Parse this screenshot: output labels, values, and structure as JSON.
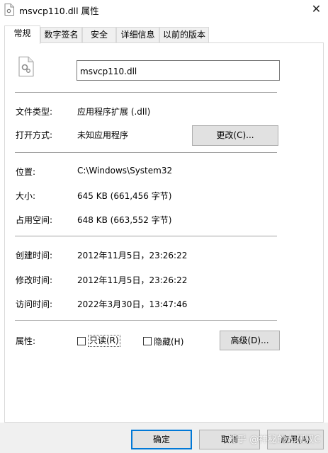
{
  "window": {
    "title": "msvcp110.dll 属性",
    "close_glyph": "✕"
  },
  "tabs": [
    {
      "label": "常规"
    },
    {
      "label": "数字签名"
    },
    {
      "label": "安全"
    },
    {
      "label": "详细信息"
    },
    {
      "label": "以前的版本"
    }
  ],
  "general": {
    "filename": "msvcp110.dll",
    "file_type_label": "文件类型:",
    "file_type_value": "应用程序扩展 (.dll)",
    "opens_with_label": "打开方式:",
    "opens_with_value": "未知应用程序",
    "change_button": "更改(C)...",
    "location_label": "位置:",
    "location_value": "C:\\Windows\\System32",
    "size_label": "大小:",
    "size_value": "645 KB (661,456 字节)",
    "size_on_disk_label": "占用空间:",
    "size_on_disk_value": "648 KB (663,552 字节)",
    "created_label": "创建时间:",
    "created_value": "2012年11月5日，23:26:22",
    "modified_label": "修改时间:",
    "modified_value": "2012年11月5日，23:26:22",
    "accessed_label": "访问时间:",
    "accessed_value": "2022年3月30日，13:47:46",
    "attributes_label": "属性:",
    "readonly_label": "只读(R)",
    "readonly_checked": false,
    "hidden_label": "隐藏(H)",
    "hidden_checked": false,
    "advanced_button": "高级(D)..."
  },
  "footer": {
    "ok_button": "确定",
    "cancel_button": "取消",
    "apply_button": "应用(A)"
  },
  "watermark": "知乎 @神秘的大叔叔C",
  "colors": {
    "accent_border": "#0078d7",
    "button_bg": "#e1e1e1",
    "separator": "#a0a0a0"
  }
}
